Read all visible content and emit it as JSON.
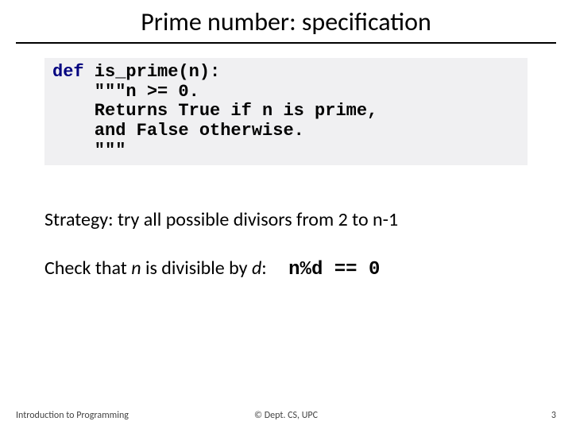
{
  "title": "Prime number: specification",
  "code": {
    "kw": "def",
    "sig": " is_prime(n):",
    "l2": "    \"\"\"n >= 0.",
    "l3": "    Returns True if n is prime,",
    "l4": "    and False otherwise.",
    "l5": "    \"\"\""
  },
  "strategy": "Strategy: try all possible divisors from 2 to n-1",
  "check": {
    "prefix": "Check that ",
    "n": "n",
    "mid": " is divisible by ",
    "d": "d",
    "suffix": ":",
    "expr": "n%d == 0"
  },
  "footer": {
    "left": "Introduction to Programming",
    "center": "© Dept. CS, UPC",
    "right": "3"
  }
}
